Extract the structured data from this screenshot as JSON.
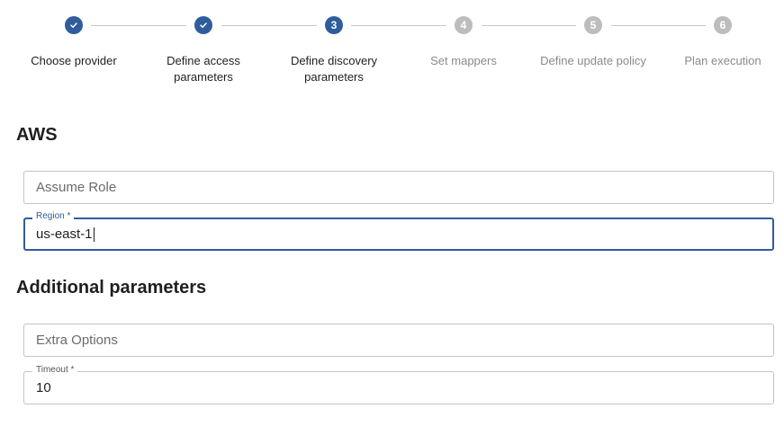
{
  "stepper": {
    "steps": [
      {
        "index": "1",
        "label_line1": "Choose provider",
        "label_line2": "",
        "status": "done",
        "icon": "check-icon"
      },
      {
        "index": "2",
        "label_line1": "Define access",
        "label_line2": "parameters",
        "status": "done",
        "icon": "check-icon"
      },
      {
        "index": "3",
        "label_line1": "Define discovery",
        "label_line2": "parameters",
        "status": "active",
        "icon": ""
      },
      {
        "index": "4",
        "label_line1": "Set mappers",
        "label_line2": "",
        "status": "pending",
        "icon": ""
      },
      {
        "index": "5",
        "label_line1": "Define update policy",
        "label_line2": "",
        "status": "pending",
        "icon": ""
      },
      {
        "index": "6",
        "label_line1": "Plan execution",
        "label_line2": "",
        "status": "pending",
        "icon": ""
      }
    ],
    "colors": {
      "active": "#2f5d9c",
      "pending": "#bdbdbd",
      "connector": "#c8c8c8"
    }
  },
  "aws": {
    "title": "AWS",
    "assume_role": {
      "placeholder": "Assume Role",
      "value": ""
    },
    "region": {
      "label": "Region *",
      "value": "us-east-1",
      "focused": true
    }
  },
  "additional": {
    "title": "Additional parameters",
    "extra_options": {
      "placeholder": "Extra Options",
      "value": ""
    },
    "timeout": {
      "label": "Timeout *",
      "value": "10"
    }
  }
}
